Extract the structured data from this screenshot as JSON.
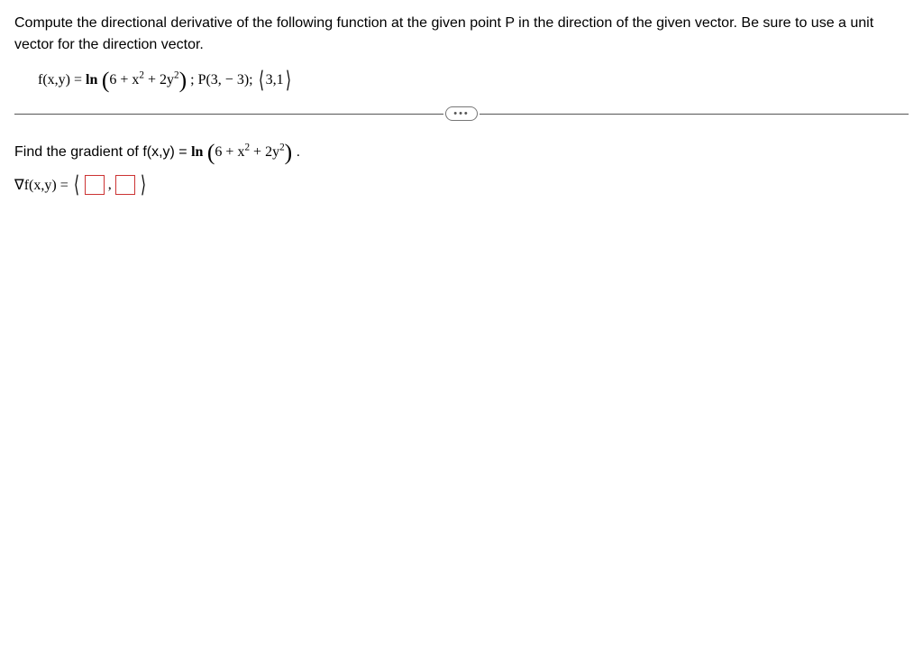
{
  "problem": {
    "intro": "Compute the directional derivative of the following function at the given point P in the direction of the given vector. Be sure to use a unit vector for the direction vector.",
    "func_lhs": "f(x,y) = ",
    "ln_label": "ln",
    "ln_arg": "6 + x",
    "ln_arg_mid": " + 2y",
    "point_sep": " ; ",
    "point": "P(3, − 3); ",
    "vector": "3,1"
  },
  "ellipsis": "•••",
  "subtask": {
    "prompt_pre": "Find the gradient of f(x,y) = ",
    "ln_label": "ln",
    "ln_arg": "6 + x",
    "ln_arg_mid": " + 2y",
    "period": " ."
  },
  "answer": {
    "lhs": "∇f(x,y) = ",
    "comma": ","
  }
}
